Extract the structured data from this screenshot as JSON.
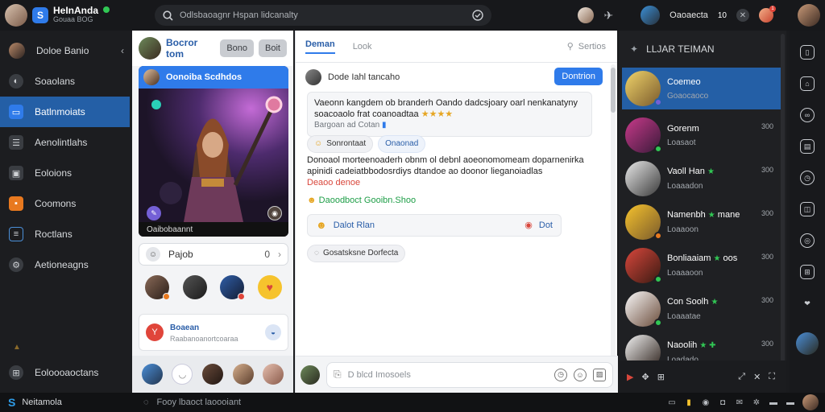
{
  "topbar": {
    "app_title": "HeInAnda",
    "app_subtitle": "Gouaa BOG",
    "search_placeholder": "Odlsbaoagnr Hspan lidcanalty",
    "user_name": "Oaoaecta",
    "user_count": "10",
    "notif_count": "1"
  },
  "sidebar": {
    "items": [
      {
        "label": "Doloe Banio",
        "icon": "profile-icon"
      },
      {
        "label": "Soaolans",
        "icon": "globe-icon"
      },
      {
        "label": "Batlnmoiats",
        "icon": "chat-icon"
      },
      {
        "label": "Aenolintlahs",
        "icon": "document-icon"
      },
      {
        "label": "Eoloions",
        "icon": "image-icon"
      },
      {
        "label": "Coomons",
        "icon": "box-icon"
      },
      {
        "label": "Roctlans",
        "icon": "list-icon"
      },
      {
        "label": "Aetioneagns",
        "icon": "gear-icon"
      }
    ],
    "bottom_label": "Eoloooaoctans"
  },
  "panel_a": {
    "title": "Bocror tom",
    "btn1": "Bono",
    "btn2": "Boit",
    "feature_title": "Oonoiba Scdhdos",
    "feature_caption": "Oaibobaannt",
    "search_label": "Pajob",
    "search_count": "0",
    "mini_title": "Boaean",
    "mini_subtitle": "Raabanoanortcoaraa"
  },
  "chat": {
    "tabs": [
      "Deman",
      "Look"
    ],
    "tab_right": "Sertios",
    "header_name": "Dode Iahl tancaho",
    "header_button": "Dontrion",
    "msg1_line1": "Vaeonn kangdem ob branderh Oando dadcsjoary oarl nenkanatyny",
    "msg1_line2": "soacoaolo frat coanoadtaa",
    "msg1_meta": "Bargoan ad Cotan",
    "chip1": "Sonrontaat",
    "chip2": "Onaonad",
    "msg2_line1": "Donoaol morteenoaderh obnm ol debnl aoeonomomeam doparnenirka",
    "msg2_line2": "apinidi cadeiatbbodosrdiys dtandoe ao doonor lieganoiadlas",
    "msg2_red": "Deaoo denoe",
    "msg3": "Daoodboct Gooibn.Shoo",
    "card_text": "Dalot Rlan",
    "card_right": "Dot",
    "chip3": "Gosatsksne Dorfecta",
    "compose_placeholder": "D blcd Imosoels"
  },
  "contacts": {
    "title": "LLJAR TEIMAN",
    "items": [
      {
        "name": "Coemeo",
        "sub": "Goaocaoco",
        "time": ""
      },
      {
        "name": "Gorenm",
        "sub": "Loasaot",
        "time": "300"
      },
      {
        "name": "Vaoll Han",
        "sub": "Loaaadon",
        "time": "300"
      },
      {
        "name": "Namenbh",
        "sub": "Loaaoon",
        "extra": "mane",
        "time": "300"
      },
      {
        "name": "Bonliaaiam",
        "sub": "Loaaaoon",
        "extra": "oos",
        "time": "300"
      },
      {
        "name": "Con Soolh",
        "sub": "Loaaatae",
        "time": "300"
      },
      {
        "name": "Naoolih",
        "sub": "Loadado",
        "time": "300"
      }
    ]
  },
  "bottombar": {
    "brand": "Neitamola",
    "status": "Fooy lbaoct laoooiant"
  }
}
